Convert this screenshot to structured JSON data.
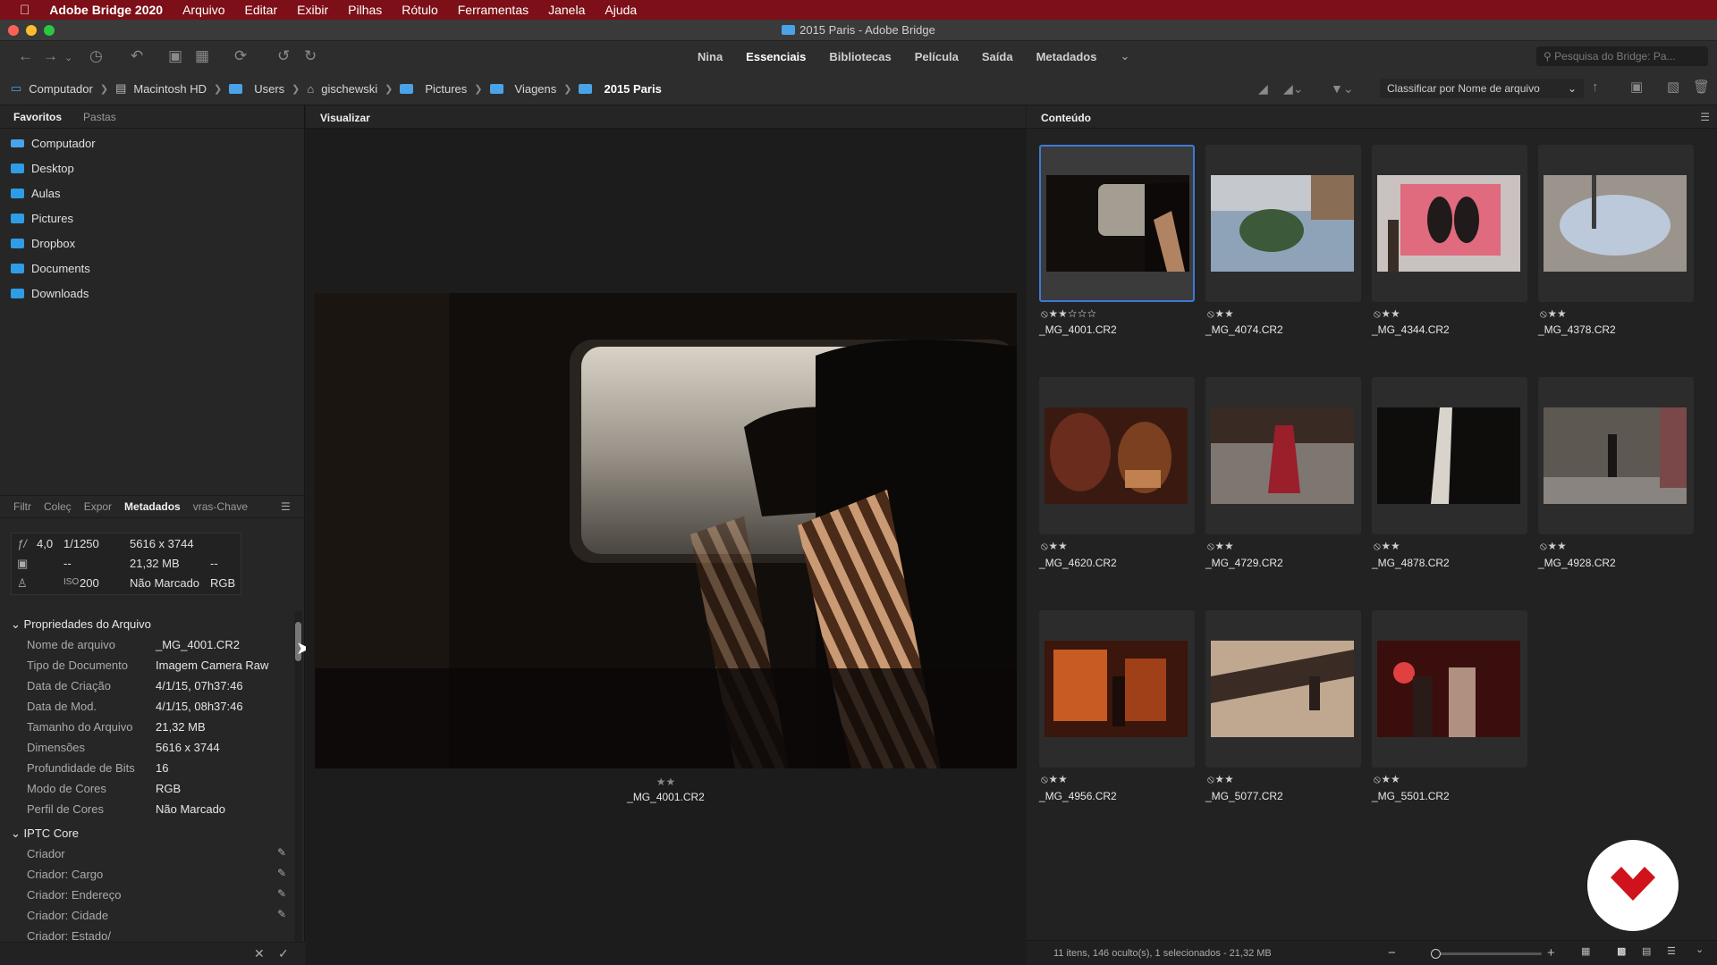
{
  "menubar": {
    "app_name": "Adobe Bridge 2020",
    "items": [
      "Arquivo",
      "Editar",
      "Exibir",
      "Pilhas",
      "Rótulo",
      "Ferramentas",
      "Janela",
      "Ajuda"
    ]
  },
  "window": {
    "title": "2015 Paris - Adobe Bridge"
  },
  "toolbar": {
    "workspaces": [
      "Nina",
      "Essenciais",
      "Bibliotecas",
      "Película",
      "Saída",
      "Metadados"
    ],
    "active_workspace": "Essenciais",
    "search_placeholder": "Pesquisa do Bridge: Pa..."
  },
  "breadcrumb": {
    "items": [
      "Computador",
      "Macintosh HD",
      "Users",
      "gischewski",
      "Pictures",
      "Viagens",
      "2015 Paris"
    ],
    "sort_label": "Classificar por Nome de arquivo"
  },
  "left_panel": {
    "tabs": [
      "Favoritos",
      "Pastas"
    ],
    "favorites": [
      "Computador",
      "Desktop",
      "Aulas",
      "Pictures",
      "Dropbox",
      "Documents",
      "Downloads"
    ],
    "meta_tabs": [
      "Filtr",
      "Coleç",
      "Expor",
      "Metadados",
      "vras-Chave"
    ],
    "placard": {
      "aperture": "4,0",
      "shutter": "1/1250",
      "dims": "5616 x 3744",
      "size": "21,32 MB",
      "dash1": "--",
      "dash2": "--",
      "dash3": "--",
      "iso_label": "ISO",
      "iso": "200",
      "profile": "Não Marcado",
      "mode": "RGB"
    },
    "file_props": {
      "header": "Propriedades do Arquivo",
      "rows": [
        {
          "label": "Nome de arquivo",
          "value": "_MG_4001.CR2"
        },
        {
          "label": "Tipo de Documento",
          "value": "Imagem Camera Raw"
        },
        {
          "label": "Data de Criação",
          "value": "4/1/15, 07h37:46"
        },
        {
          "label": "Data de Mod.",
          "value": "4/1/15, 08h37:46"
        },
        {
          "label": "Tamanho do Arquivo",
          "value": "21,32 MB"
        },
        {
          "label": "Dimensões",
          "value": "5616 x 3744"
        },
        {
          "label": "Profundidade de Bits",
          "value": "16"
        },
        {
          "label": "Modo de Cores",
          "value": "RGB"
        },
        {
          "label": "Perfil de Cores",
          "value": "Não Marcado"
        }
      ]
    },
    "iptc": {
      "header": "IPTC Core",
      "rows": [
        "Criador",
        "Criador: Cargo",
        "Criador: Endereço",
        "Criador: Cidade",
        "Criador: Estado/"
      ]
    }
  },
  "preview": {
    "tab": "Visualizar",
    "rating": "★★",
    "filename": "_MG_4001.CR2"
  },
  "content": {
    "tab": "Conteúdo",
    "items": [
      {
        "name": "_MG_4001.CR2",
        "rating": "⦸★★☆☆☆",
        "selected": true
      },
      {
        "name": "_MG_4074.CR2",
        "rating": "⦸★★"
      },
      {
        "name": "_MG_4344.CR2",
        "rating": "⦸★★"
      },
      {
        "name": "_MG_4378.CR2",
        "rating": "⦸★★"
      },
      {
        "name": "_MG_4620.CR2",
        "rating": "⦸★★"
      },
      {
        "name": "_MG_4729.CR2",
        "rating": "⦸★★"
      },
      {
        "name": "_MG_4878.CR2",
        "rating": "⦸★★"
      },
      {
        "name": "_MG_4928.CR2",
        "rating": "⦸★★"
      },
      {
        "name": "_MG_4956.CR2",
        "rating": "⦸★★"
      },
      {
        "name": "_MG_5077.CR2",
        "rating": "⦸★★"
      },
      {
        "name": "_MG_5501.CR2",
        "rating": "⦸★★"
      }
    ],
    "status": "11 itens, 146 oculto(s), 1 selecionados - 21,32 MB"
  },
  "colors": {
    "menubar": "#7c0f17",
    "selection": "#3d7ad6",
    "folder": "#2f9ce6",
    "logo_red": "#d0121c"
  }
}
